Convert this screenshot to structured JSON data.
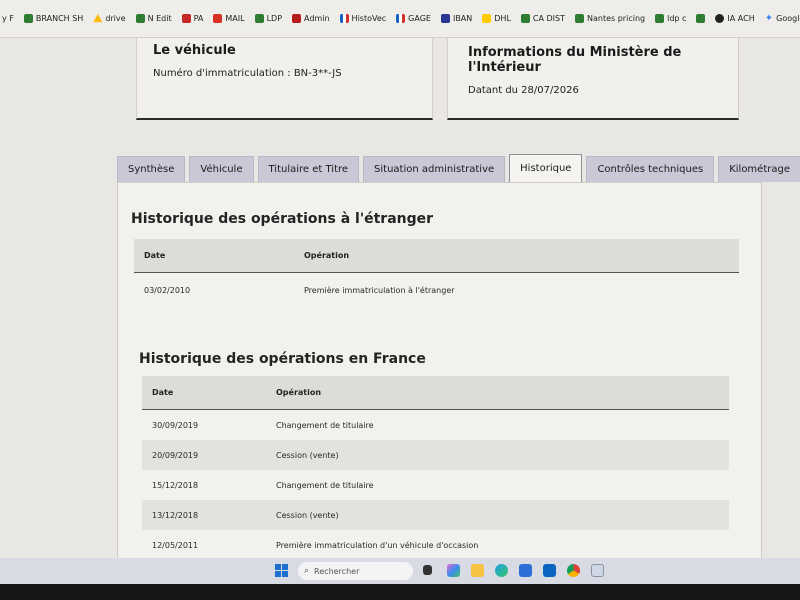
{
  "bookmarks": [
    {
      "label": "y F",
      "color": "#ffffff"
    },
    {
      "label": "BRANCH SH",
      "color": "#2e7d32"
    },
    {
      "label": "drive",
      "color": "#fbbc04"
    },
    {
      "label": "N Edit",
      "color": "#2e7d32"
    },
    {
      "label": "PA",
      "color": "#c62828"
    },
    {
      "label": "MAIL",
      "color": "#d93025"
    },
    {
      "label": "LDP",
      "color": "#2e7d32"
    },
    {
      "label": "Admin",
      "color": "#b71c1c"
    },
    {
      "label": "HistoVec",
      "color": "#1565c0"
    },
    {
      "label": "GAGE",
      "color": "#1565c0"
    },
    {
      "label": "IBAN",
      "color": "#283593"
    },
    {
      "label": "DHL",
      "color": "#ffcc00"
    },
    {
      "label": "CA DIST",
      "color": "#2e7d32"
    },
    {
      "label": "Nantes pricing",
      "color": "#2e7d32"
    },
    {
      "label": "ldp c",
      "color": "#2e7d32"
    },
    {
      "label": "",
      "color": "#2e7d32"
    },
    {
      "label": "IA ACH",
      "color": "#222222"
    },
    {
      "label": "Google Gemini",
      "color": "#4285f4"
    }
  ],
  "vehicle_card": {
    "title": "Le véhicule",
    "registration": "Numéro d'immatriculation : BN-3**-JS"
  },
  "ministry_card": {
    "title": "Informations du Ministère de l'Intérieur",
    "date": "Datant du 28/07/2026"
  },
  "tabs": [
    {
      "label": "Synthèse",
      "active": false
    },
    {
      "label": "Véhicule",
      "active": false
    },
    {
      "label": "Titulaire et Titre",
      "active": false
    },
    {
      "label": "Situation administrative",
      "active": false
    },
    {
      "label": "Historique",
      "active": true
    },
    {
      "label": "Contrôles techniques",
      "active": false
    },
    {
      "label": "Kilométrage",
      "active": false
    }
  ],
  "foreign_history": {
    "title": "Historique des opérations à l'étranger",
    "col_date": "Date",
    "col_operation": "Opération",
    "rows": [
      {
        "date": "03/02/2010",
        "operation": "Première immatriculation à l'étranger"
      }
    ]
  },
  "france_history": {
    "title": "Historique des opérations en France",
    "col_date": "Date",
    "col_operation": "Opération",
    "rows": [
      {
        "date": "30/09/2019",
        "operation": "Changement de titulaire"
      },
      {
        "date": "20/09/2019",
        "operation": "Cession (vente)"
      },
      {
        "date": "15/12/2018",
        "operation": "Changement de titulaire"
      },
      {
        "date": "13/12/2018",
        "operation": "Cession (vente)"
      },
      {
        "date": "12/05/2011",
        "operation": "Première immatriculation d'un véhicule d'occasion"
      }
    ]
  },
  "taskbar": {
    "search_placeholder": "Rechercher"
  }
}
